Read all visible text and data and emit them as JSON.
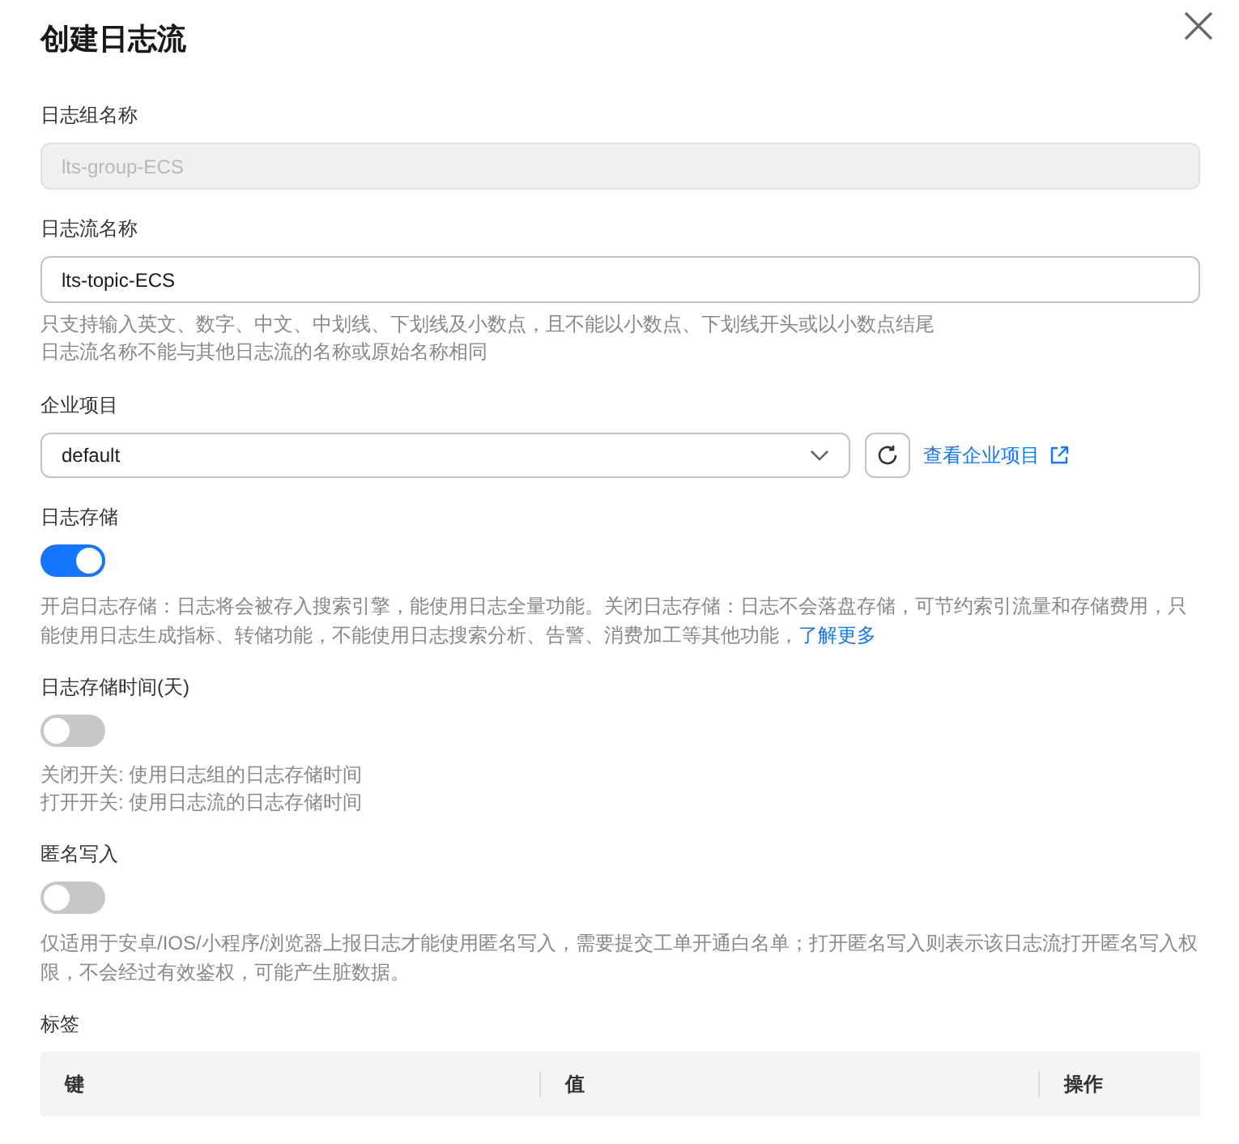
{
  "dialog": {
    "title": "创建日志流"
  },
  "fields": [
    {
      "kind": "input",
      "label": "日志组名称",
      "value": "lts-group-ECS",
      "disabled": true
    },
    {
      "kind": "input",
      "label": "日志流名称",
      "value": "lts-topic-ECS",
      "disabled": false,
      "hints": [
        "只支持输入英文、数字、中文、中划线、下划线及小数点，且不能以小数点、下划线开头或以小数点结尾",
        "日志流名称不能与其他日志流的名称或原始名称相同"
      ]
    },
    {
      "kind": "select",
      "label": "企业项目",
      "value": "default",
      "link": "查看企业项目"
    },
    {
      "kind": "switch",
      "label": "日志存储",
      "on": true,
      "description": "开启日志存储：日志将会被存入搜索引擎，能使用日志全量功能。关闭日志存储：日志不会落盘存储，可节约索引流量和存储费用，只能使用日志生成指标、转储功能，不能使用日志搜索分析、告警、消费加工等其他功能，",
      "link": "了解更多"
    },
    {
      "kind": "switch",
      "label": "日志存储时间(天)",
      "on": false,
      "hints": [
        "关闭开关: 使用日志组的日志存储时间",
        "打开开关: 使用日志流的日志存储时间"
      ]
    },
    {
      "kind": "switch",
      "label": "匿名写入",
      "on": false,
      "description": "仅适用于安卓/IOS/小程序/浏览器上报日志才能使用匿名写入，需要提交工单开通白名单；打开匿名写入则表示该日志流打开匿名写入权限，不会经过有效鉴权，可能产生脏数据。"
    },
    {
      "kind": "table",
      "label": "标签",
      "columns": [
        "键",
        "值",
        "操作"
      ]
    }
  ]
}
